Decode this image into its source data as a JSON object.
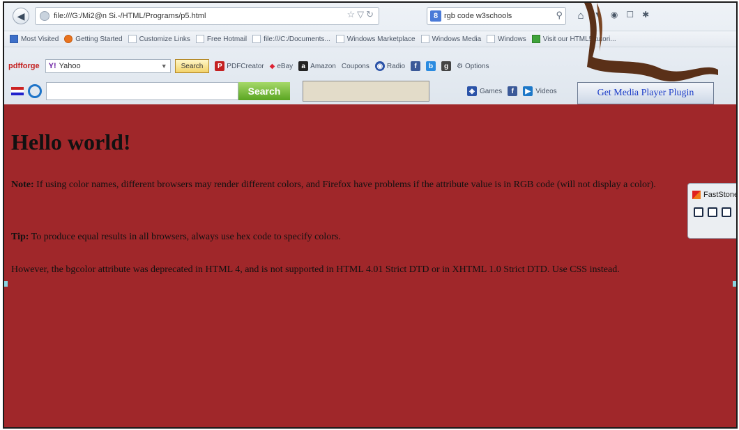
{
  "browser": {
    "url": "file:///G:/Mi2@n Si.-/HTML/Programs/p5.html",
    "search_engine_badge": "8",
    "search_query": "rgb code w3schools"
  },
  "bookmarks": [
    {
      "label": "Most Visited",
      "icon": "bookmark-blue-icon"
    },
    {
      "label": "Getting Started",
      "icon": "firefox-icon"
    },
    {
      "label": "Customize Links",
      "icon": "page-icon"
    },
    {
      "label": "Free Hotmail",
      "icon": "page-icon"
    },
    {
      "label": "file:///C:/Documents...",
      "icon": "page-icon"
    },
    {
      "label": "Windows Marketplace",
      "icon": "page-icon"
    },
    {
      "label": "Windows Media",
      "icon": "page-icon"
    },
    {
      "label": "Windows",
      "icon": "page-icon"
    },
    {
      "label": "Visit our HTML5 tutori...",
      "icon": "html5-icon"
    }
  ],
  "toolbar": {
    "pdfforge_label": "pdfforge",
    "yahoo_value": "Yahoo",
    "search_button": "Search",
    "pdfcreator": "PDFCreator",
    "ebay": "eBay",
    "amazon_badge": "a",
    "amazon": "Amazon",
    "coupons": "Coupons",
    "radio": "Radio",
    "options": "Options"
  },
  "toolbar2": {
    "search_button": "Search",
    "games": "Games",
    "videos": "Videos",
    "media_plugin": "Get Media Player Plugin"
  },
  "page": {
    "heading": "Hello world!",
    "note_label": "Note:",
    "note_text": " If using color names, different browsers may render different colors, and Firefox have problems if the attribute value is in RGB code (will not display a color).",
    "tip_label": "Tip:",
    "tip_text": " To produce equal results in all browsers, always use hex code to specify colors.",
    "however_text": "However, the bgcolor attribute was deprecated in HTML 4, and is not supported in HTML 4.01 Strict DTD or in XHTML 1.0 Strict DTD. Use CSS instead."
  },
  "faststone": {
    "title": "FastStone"
  },
  "colors": {
    "page_background": "#a0272a",
    "heading_text": "#111111"
  }
}
